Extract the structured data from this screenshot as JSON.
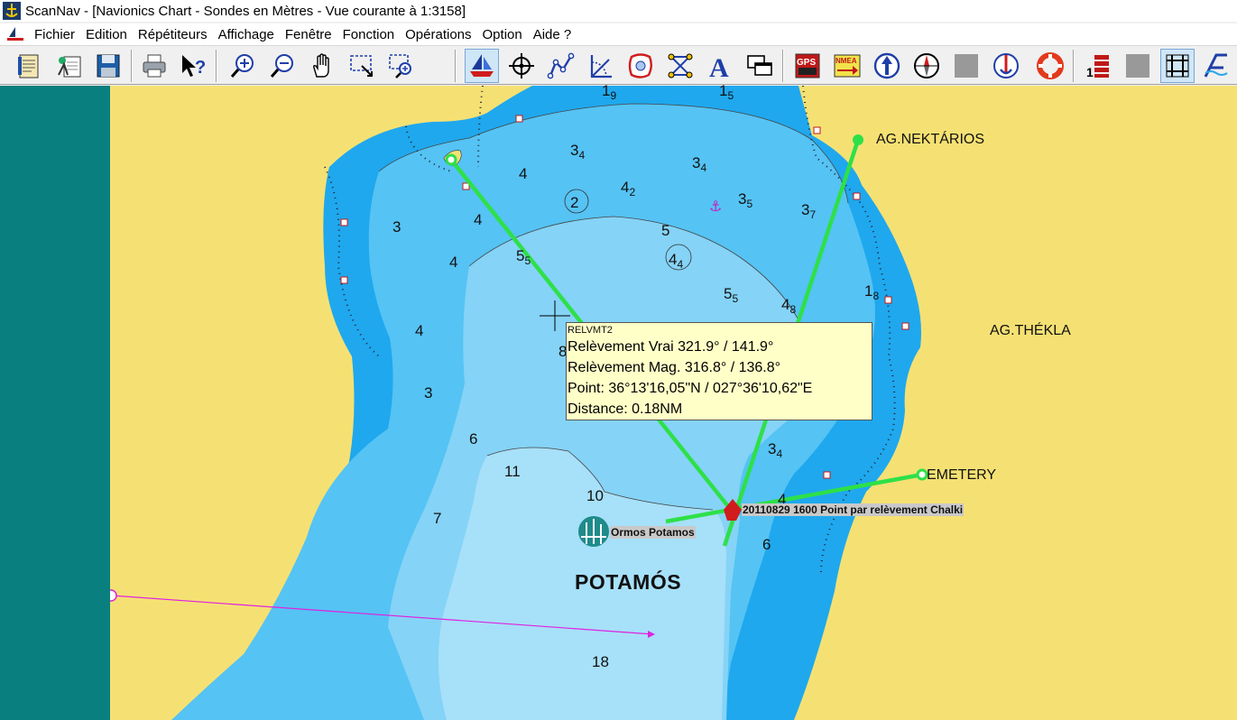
{
  "window": {
    "title": "ScanNav - [Navionics Chart - Sondes en  Mètres - Vue courante à 1:3158]"
  },
  "menu": {
    "items": [
      "Fichier",
      "Edition",
      "Répétiteurs",
      "Affichage",
      "Fenêtre",
      "Fonction",
      "Opérations",
      "Option",
      "Aide ?"
    ]
  },
  "toolbar": {
    "buttons": [
      {
        "name": "notebook-button",
        "icon": "notebook-icon"
      },
      {
        "name": "wizard-button",
        "icon": "wizard-icon"
      },
      {
        "name": "save-button",
        "icon": "floppy-icon"
      },
      {
        "name": "print-button",
        "icon": "printer-icon"
      },
      {
        "name": "help-pointer-button",
        "icon": "help-arrow-icon"
      },
      {
        "name": "zoom-in-button",
        "icon": "zoom-in-icon"
      },
      {
        "name": "zoom-out-button",
        "icon": "zoom-out-icon"
      },
      {
        "name": "pan-button",
        "icon": "hand-icon"
      },
      {
        "name": "select-zone-button",
        "icon": "select-area-icon"
      },
      {
        "name": "zoom-zone-button",
        "icon": "zoom-area-icon"
      },
      {
        "name": "boat-button",
        "icon": "sailboat-icon"
      },
      {
        "name": "crosshair-button",
        "icon": "crosshair-icon"
      },
      {
        "name": "route-button",
        "icon": "route-icon"
      },
      {
        "name": "bearing-button",
        "icon": "bearing-icon"
      },
      {
        "name": "zone-button",
        "icon": "zone-icon"
      },
      {
        "name": "network-button",
        "icon": "network-icon"
      },
      {
        "name": "text-button",
        "icon": "text-a-icon"
      },
      {
        "name": "windows-button",
        "icon": "windows-icon"
      },
      {
        "name": "gps-button",
        "icon": "gps-icon",
        "label": "GPS"
      },
      {
        "name": "nmea-button",
        "icon": "nmea-icon",
        "label": "NMEA"
      },
      {
        "name": "north-up-button",
        "icon": "north-up-icon"
      },
      {
        "name": "compass-button",
        "icon": "compass-icon"
      },
      {
        "name": "disabled-button-1",
        "icon": "blank-icon"
      },
      {
        "name": "anchor-button",
        "icon": "mooring-icon"
      },
      {
        "name": "lifebuoy-button",
        "icon": "lifebuoy-icon"
      },
      {
        "name": "list-button",
        "icon": "list-icon",
        "label": "1"
      },
      {
        "name": "disabled-button-2",
        "icon": "blank-icon"
      },
      {
        "name": "grid-button",
        "icon": "grid-icon"
      },
      {
        "name": "tide-button",
        "icon": "tide-icon"
      }
    ]
  },
  "chart": {
    "colors": {
      "land": "#f5e173",
      "deep_water": "#1fa8ee",
      "mid_water": "#55c3f4",
      "shallow_water": "#85d3f7",
      "very_shallow": "#a7e0f9",
      "bearing_line": "#2ee048",
      "route_line": "#e020e0",
      "left_panel": "#0a7f7f"
    },
    "depths": [
      {
        "v": "1",
        "s": "9"
      },
      {
        "v": "1",
        "s": "5"
      },
      {
        "v": "3",
        "s": "4"
      },
      {
        "v": "4",
        "s": ""
      },
      {
        "v": "3",
        "s": "4"
      },
      {
        "v": "4",
        "s": "2"
      },
      {
        "v": "2",
        "s": ""
      },
      {
        "v": "3",
        "s": "5"
      },
      {
        "v": "3",
        "s": "7"
      },
      {
        "v": "3",
        "s": ""
      },
      {
        "v": "4",
        "s": ""
      },
      {
        "v": "5",
        "s": ""
      },
      {
        "v": "4",
        "s": ""
      },
      {
        "v": "5",
        "s": "5"
      },
      {
        "v": "4",
        "s": "4"
      },
      {
        "v": "5",
        "s": "5"
      },
      {
        "v": "4",
        "s": "8"
      },
      {
        "v": "1",
        "s": "8"
      },
      {
        "v": "4",
        "s": ""
      },
      {
        "v": "8",
        "s": ""
      },
      {
        "v": "3",
        "s": ""
      },
      {
        "v": "6",
        "s": ""
      },
      {
        "v": "3",
        "s": "4"
      },
      {
        "v": "11",
        "s": ""
      },
      {
        "v": "10",
        "s": ""
      },
      {
        "v": "4",
        "s": ""
      },
      {
        "v": "7",
        "s": ""
      },
      {
        "v": "6",
        "s": ""
      },
      {
        "v": "18",
        "s": ""
      }
    ],
    "places": {
      "nektarios": "AG.NEKTÁRIOS",
      "thekla": "AG.THÉKLA",
      "cemetery": "EMETERY",
      "town": "POTAMÓS"
    },
    "markers": {
      "harbour": "Ormos Potamos",
      "fix": "20110829 1600 Point par relèvement Chalki"
    },
    "tooltip": {
      "header": "RELVMT2",
      "lines": [
        "Relèvement Vrai 321.9° / 141.9°",
        "Relèvement Mag. 316.8° / 136.8°",
        "Point: 36°13'16,05\"N / 027°36'10,62\"E",
        "Distance: 0.18NM"
      ]
    }
  }
}
